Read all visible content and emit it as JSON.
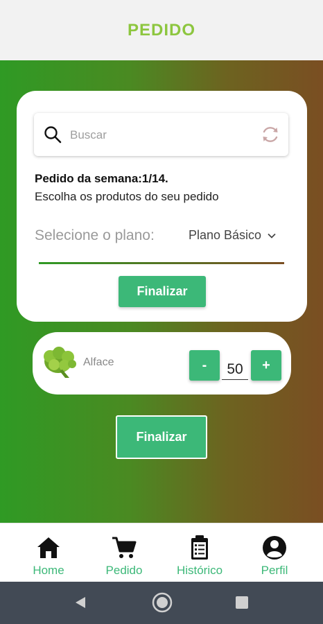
{
  "header": {
    "title": "PEDIDO"
  },
  "search": {
    "placeholder": "Buscar"
  },
  "order": {
    "week_text": "Pedido da semana:1/14.",
    "instruction": "Escolha os produtos do seu pedido"
  },
  "plan": {
    "label": "Selecione o plano:",
    "selected": "Plano Básico"
  },
  "card": {
    "finish_label": "Finalizar"
  },
  "product": {
    "name": "Alface",
    "minus_label": "-",
    "plus_label": "+",
    "quantity": "50"
  },
  "main": {
    "finish_label": "Finalizar"
  },
  "nav": {
    "items": [
      {
        "label": "Home",
        "icon": "home-icon"
      },
      {
        "label": "Pedido",
        "icon": "cart-icon"
      },
      {
        "label": "Histórico",
        "icon": "clipboard-icon"
      },
      {
        "label": "Perfil",
        "icon": "account-icon"
      }
    ]
  },
  "colors": {
    "accent": "#3cb878",
    "title": "#8dc63f",
    "gradient_start": "#2f9a24",
    "gradient_end": "#7a4e22",
    "system_bar": "#424a55"
  }
}
